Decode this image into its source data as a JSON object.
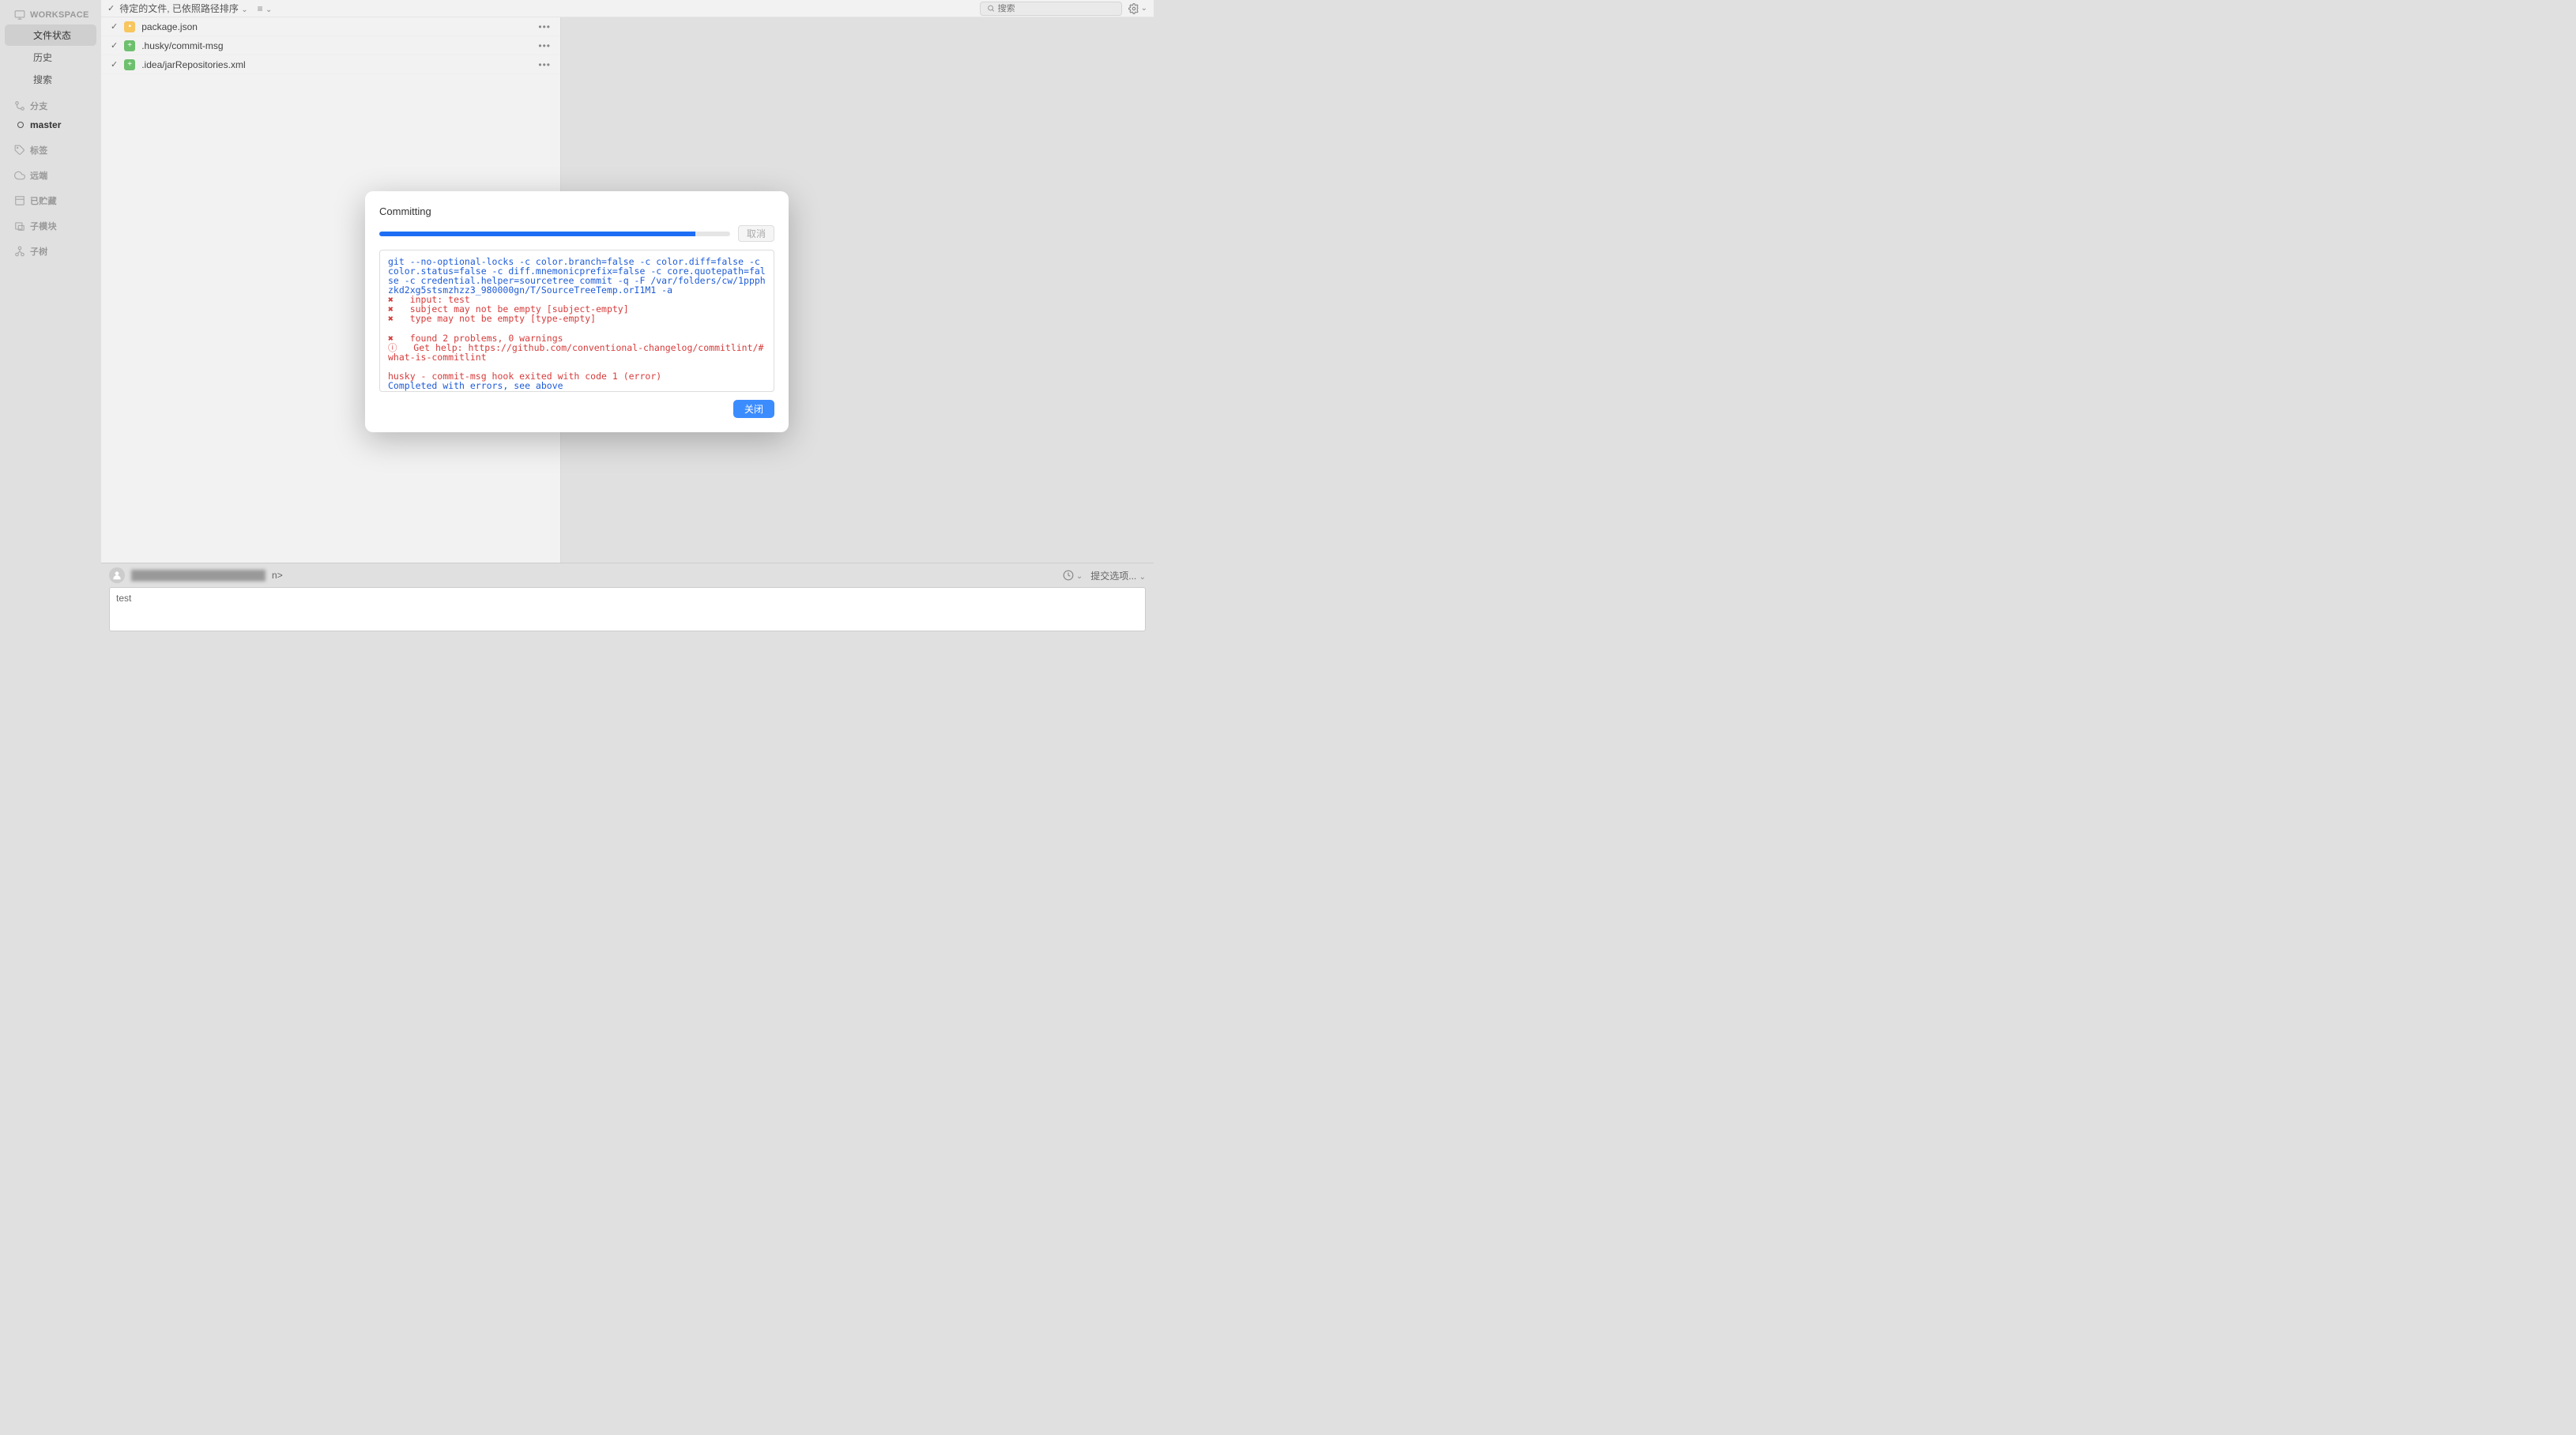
{
  "sidebar": {
    "workspace_label": "WORKSPACE",
    "items": {
      "file_status": "文件状态",
      "history": "历史",
      "search": "搜索"
    },
    "branch_label": "分支",
    "branch_name": "master",
    "tags_label": "标签",
    "remotes_label": "远端",
    "stashes_label": "已贮藏",
    "submodules_label": "子模块",
    "subtrees_label": "子树"
  },
  "toolbar": {
    "pending_label": "待定的文件, 已依照路径排序",
    "list_mode_icon": "list-icon",
    "search_placeholder": "搜索"
  },
  "files": [
    {
      "name": "package.json",
      "icon": "folder"
    },
    {
      "name": ".husky/commit-msg",
      "icon": "add"
    },
    {
      "name": ".idea/jarRepositories.xml",
      "icon": "add"
    }
  ],
  "commit": {
    "author_suffix": "n>",
    "options_label": "提交选项...",
    "message": "test"
  },
  "modal": {
    "title": "Committing",
    "cancel": "取消",
    "close": "关闭",
    "progress_pct": 90,
    "log": {
      "cmd": "git --no-optional-locks -c color.branch=false -c color.diff=false -c color.status=false -c diff.mnemonicprefix=false -c core.quotepath=false -c credential.helper=sourcetree commit -q -F /var/folders/cw/1ppphzkd2xg5stsmzhzz3_980000gn/T/SourceTreeTemp.orI1M1 -a",
      "err1": "✖   input: test",
      "err2": "✖   subject may not be empty [subject-empty]",
      "err3": "✖   type may not be empty [type-empty]",
      "err4": "✖   found 2 problems, 0 warnings",
      "err5": "ⓘ   Get help: https://github.com/conventional-changelog/commitlint/#what-is-commitlint",
      "err6": "husky - commit-msg hook exited with code 1 (error)",
      "done": "Completed with errors, see above"
    }
  }
}
